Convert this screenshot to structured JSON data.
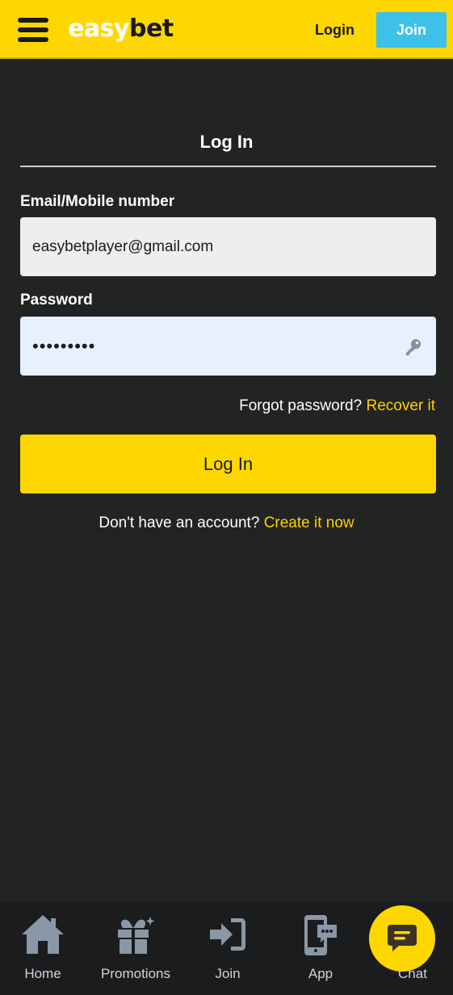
{
  "header": {
    "logo_part1": "easy",
    "logo_part2": "bet",
    "login_label": "Login",
    "join_label": "Join"
  },
  "form": {
    "title": "Log In",
    "email_label": "Email/Mobile number",
    "email_value": "easybetplayer@gmail.com",
    "password_label": "Password",
    "password_value": "•••••••••",
    "forgot_text": "Forgot password?",
    "recover_link": "Recover it",
    "submit_label": "Log In",
    "no_account_text": "Don't have an account?",
    "create_link": "Create it now"
  },
  "bottom_nav": {
    "items": [
      {
        "label": "Home",
        "icon": "home-icon"
      },
      {
        "label": "Promotions",
        "icon": "gift-icon"
      },
      {
        "label": "Join",
        "icon": "sign-in-icon"
      },
      {
        "label": "App",
        "icon": "mobile-app-icon"
      },
      {
        "label": "Chat",
        "icon": "chat-icon"
      }
    ]
  },
  "colors": {
    "brand_yellow": "#ffd700",
    "join_blue": "#3ec1e8",
    "background": "#222323",
    "nav_icon": "#8a97a6"
  }
}
